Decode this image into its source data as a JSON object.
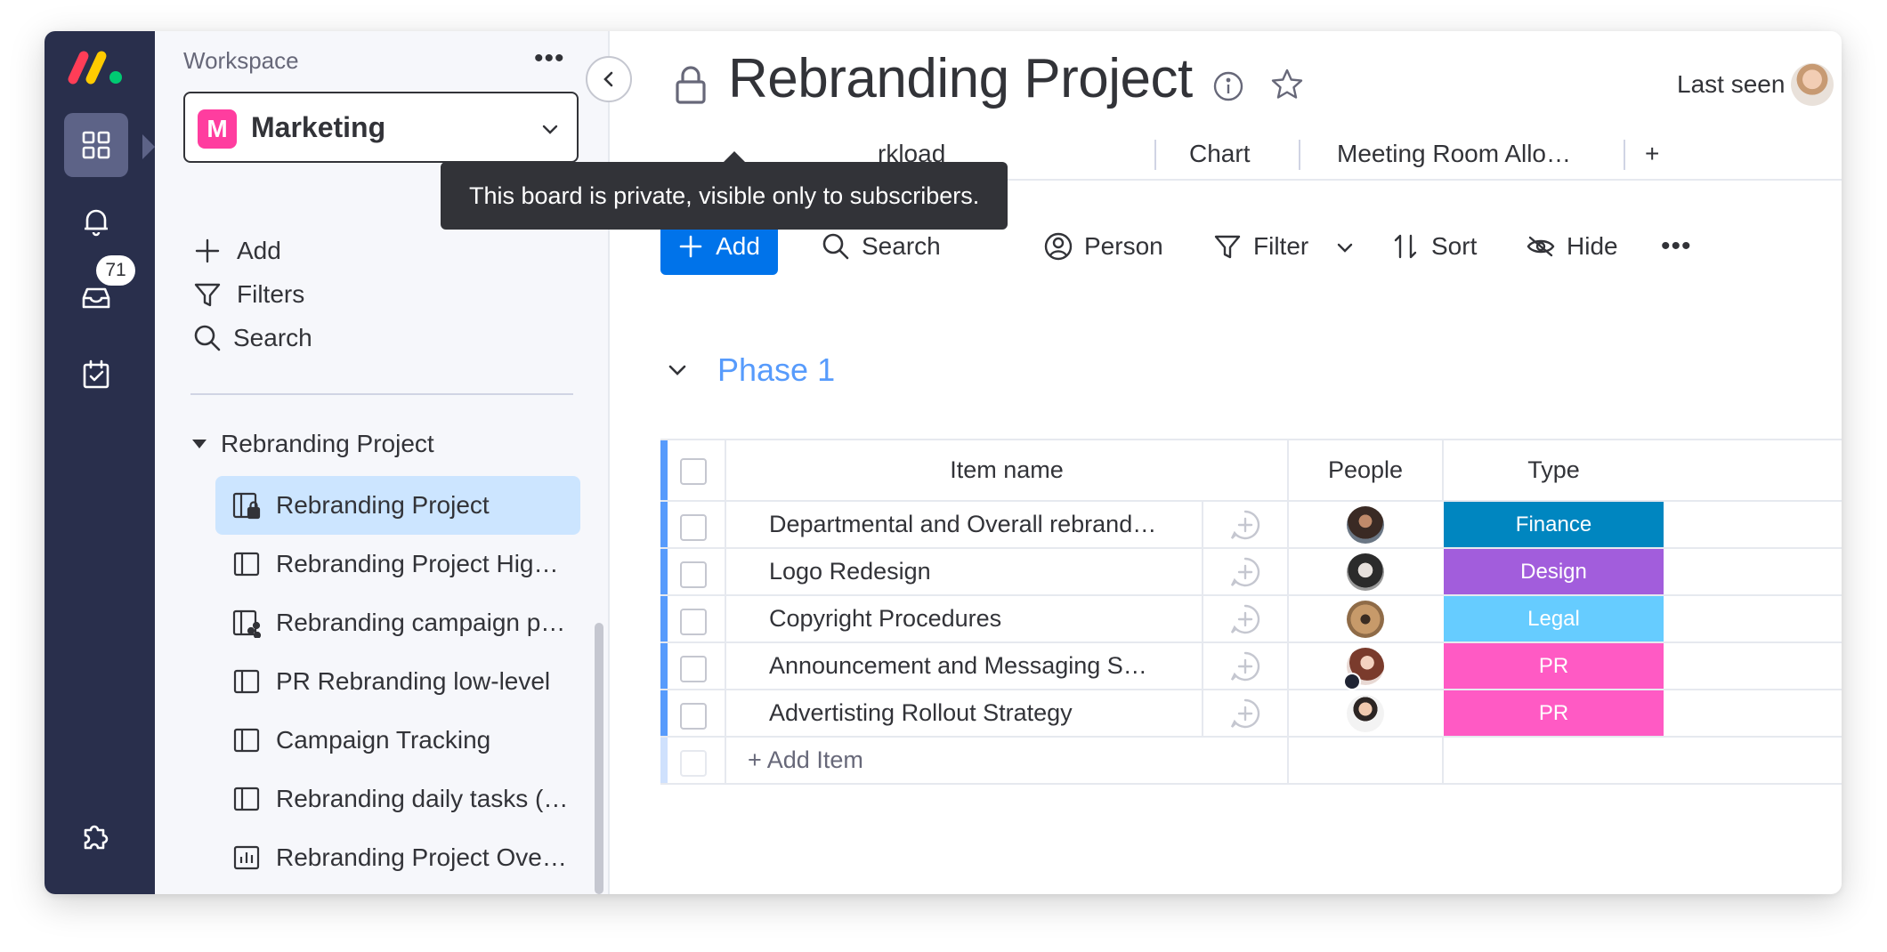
{
  "sidebar": {
    "workspace_label": "Workspace",
    "more": "•••",
    "workspace_initial": "M",
    "workspace_name": "Marketing",
    "add_label": "Add",
    "filters_label": "Filters",
    "search_label": "Search",
    "group_label": "Rebranding Project",
    "notification_badge": "71",
    "boards": [
      {
        "label": "Rebranding Project",
        "icon": "private-board-icon"
      },
      {
        "label": "Rebranding Project Hig…",
        "icon": "board-icon"
      },
      {
        "label": "Rebranding campaign p…",
        "icon": "shareable-board-icon"
      },
      {
        "label": "PR Rebranding low-level",
        "icon": "board-icon"
      },
      {
        "label": "Campaign Tracking",
        "icon": "board-icon"
      },
      {
        "label": "Rebranding daily tasks (…",
        "icon": "board-icon"
      },
      {
        "label": "Rebranding Project Ove…",
        "icon": "dashboard-icon"
      }
    ]
  },
  "header": {
    "title": "Rebranding Project",
    "last_seen": "Last seen"
  },
  "tabs": [
    {
      "label": "rkload"
    },
    {
      "label": "Chart"
    },
    {
      "label": "Meeting Room Allo…"
    },
    {
      "label": "+"
    }
  ],
  "tooltip": "This board is private, visible only to subscribers.",
  "toolbar": {
    "add": "Add",
    "search": "Search",
    "person": "Person",
    "filter": "Filter",
    "sort": "Sort",
    "hide": "Hide",
    "more": "•••"
  },
  "group": {
    "title": "Phase 1"
  },
  "table": {
    "columns": {
      "name": "Item name",
      "people": "People",
      "type": "Type"
    },
    "rows": [
      {
        "name": "Departmental and Overall rebrand…",
        "type": "Finance",
        "type_color": "#037f4c"
      },
      {
        "name": "Logo Redesign",
        "type": "Design",
        "type_color": "#a25ddc"
      },
      {
        "name": "Copyright Procedures",
        "type": "Legal",
        "type_color": "#66ccff"
      },
      {
        "name": "Announcement and Messaging S…",
        "type": "PR",
        "type_color": "#ff5ac4"
      },
      {
        "name": "Advertisting Rollout Strategy",
        "type": "PR",
        "type_color": "#ff5ac4"
      }
    ],
    "add_item": "+ Add Item"
  },
  "colors": {
    "rail": "#292f4c",
    "primary": "#0073ea",
    "group": "#579bfc",
    "finance": "#0086c0",
    "design": "#a25ddc",
    "legal": "#66ccff",
    "pr": "#ff5ac4"
  }
}
